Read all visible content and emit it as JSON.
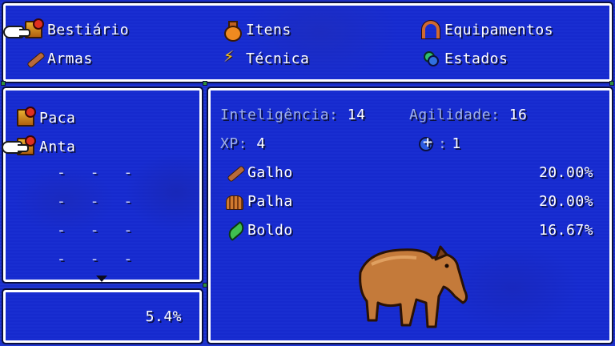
{
  "menu": {
    "items": [
      {
        "label": "Bestiário",
        "icon": "book-icon"
      },
      {
        "label": "Itens",
        "icon": "potion-icon"
      },
      {
        "label": "Equipamentos",
        "icon": "horseshoe-icon"
      },
      {
        "label": "Armas",
        "icon": "stick-icon"
      },
      {
        "label": "Técnica",
        "icon": "lightning-icon"
      },
      {
        "label": "Estados",
        "icon": "status-icon"
      }
    ]
  },
  "bestiary": {
    "entries": [
      "Paca",
      "Anta"
    ],
    "empty_entries": [
      "- - -",
      "- - -",
      "- - -",
      "- - -"
    ],
    "completion": "5.4%"
  },
  "details": {
    "stats": {
      "intelligence_label": "Inteligência:",
      "intelligence_value": "14",
      "agility_label": "Agilidade:",
      "agility_value": "16",
      "xp_label": "XP:",
      "xp_value": "4",
      "bonus_label": ":",
      "bonus_value": "1"
    },
    "drops": [
      {
        "name": "Galho",
        "chance": "20.00%",
        "icon": "stick-icon"
      },
      {
        "name": "Palha",
        "chance": "20.00%",
        "icon": "hay-icon"
      },
      {
        "name": "Boldo",
        "chance": "16.67%",
        "icon": "leaf-icon"
      }
    ]
  },
  "colors": {
    "background": "#1a2fd0",
    "border": "#ffffff",
    "label_dim": "#9fb0e6"
  }
}
